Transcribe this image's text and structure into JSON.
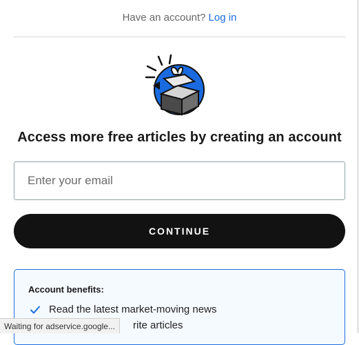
{
  "header": {
    "prompt_text": "Have an account?",
    "login_label": "Log in"
  },
  "main": {
    "headline": "Access more free articles by creating an account",
    "email_placeholder": "Enter your email",
    "continue_label": "CONTINUE"
  },
  "benefits": {
    "title": "Account benefits:",
    "items": [
      {
        "text": "Read the latest market-moving news"
      },
      {
        "text": "rite articles"
      }
    ]
  },
  "status_bar": {
    "text": "Waiting for adservice.google..."
  },
  "colors": {
    "link": "#1a6be0",
    "button_bg": "#121212",
    "benefits_border": "#1a6be0",
    "benefits_bg": "#f5faff",
    "illustration_circle": "#1a6be0"
  },
  "icons": {
    "illustration": "gift-box-illustration",
    "check": "check-icon"
  }
}
